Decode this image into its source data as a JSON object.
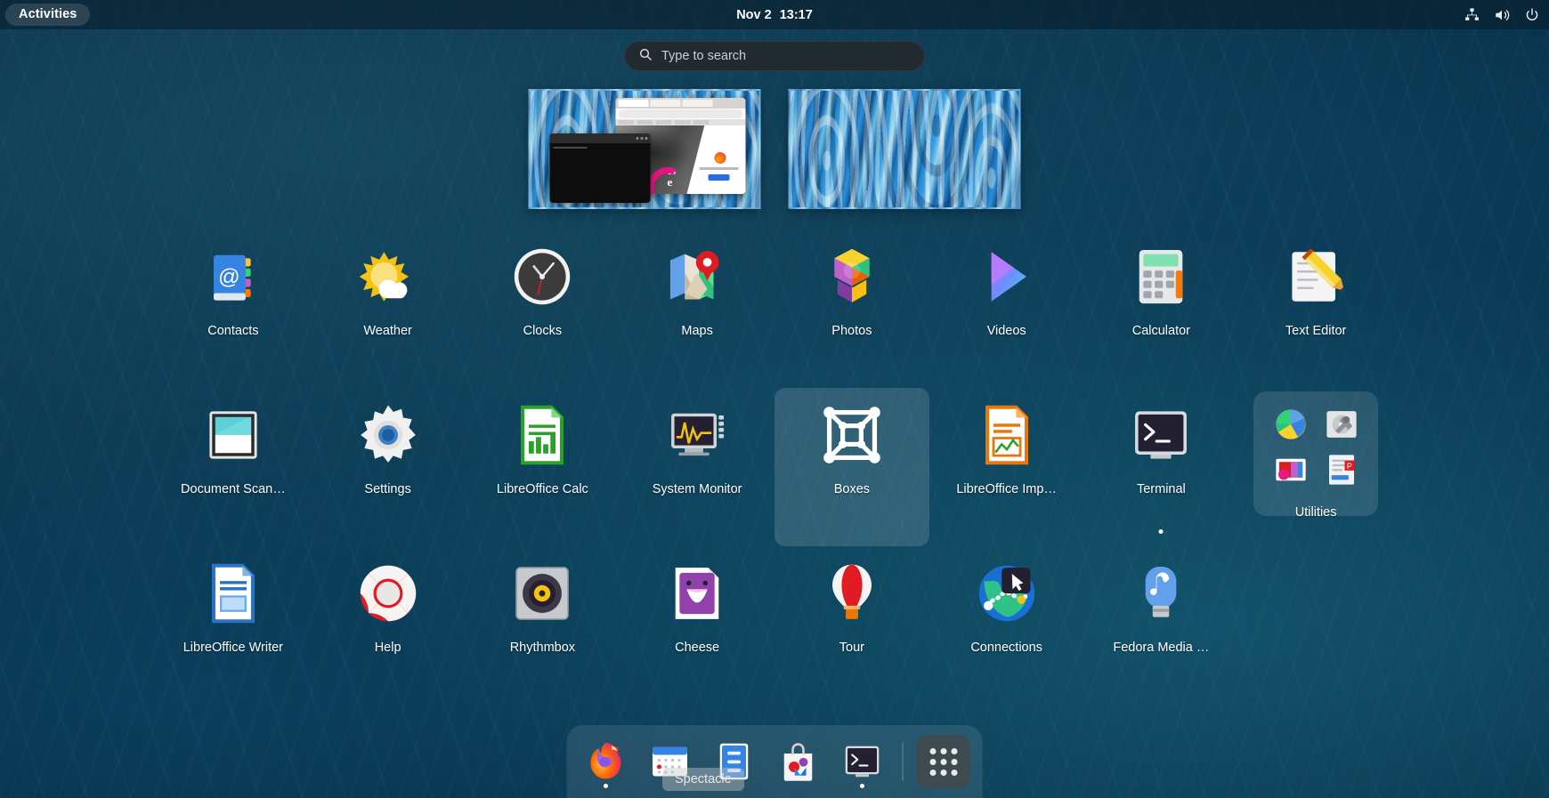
{
  "topbar": {
    "activities_label": "Activities",
    "date": "Nov 2",
    "time": "13:17",
    "tray": [
      {
        "name": "network-wired-icon",
        "label": "Network"
      },
      {
        "name": "volume-icon",
        "label": "Volume"
      },
      {
        "name": "power-icon",
        "label": "Power"
      }
    ]
  },
  "search": {
    "placeholder": "Type to search",
    "value": "",
    "icon": "search-icon"
  },
  "workspaces": [
    {
      "name": "workspace-1",
      "active": true,
      "windows": [
        "Firefox",
        "Terminal"
      ]
    },
    {
      "name": "workspace-2",
      "active": false,
      "windows": []
    }
  ],
  "appgrid": {
    "rows": [
      [
        {
          "label": "Contacts",
          "icon": "contacts-icon",
          "running": false,
          "highlight": false
        },
        {
          "label": "Weather",
          "icon": "weather-icon",
          "running": false,
          "highlight": false
        },
        {
          "label": "Clocks",
          "icon": "clocks-icon",
          "running": false,
          "highlight": false
        },
        {
          "label": "Maps",
          "icon": "maps-icon",
          "running": false,
          "highlight": false
        },
        {
          "label": "Photos",
          "icon": "photos-icon",
          "running": false,
          "highlight": false
        },
        {
          "label": "Videos",
          "icon": "videos-icon",
          "running": false,
          "highlight": false
        },
        {
          "label": "Calculator",
          "icon": "calculator-icon",
          "running": false,
          "highlight": false
        },
        {
          "label": "Text Editor",
          "icon": "text-editor-icon",
          "running": false,
          "highlight": false
        }
      ],
      [
        {
          "label": "Document Scan…",
          "icon": "document-scanner-icon",
          "running": false,
          "highlight": false
        },
        {
          "label": "Settings",
          "icon": "settings-icon",
          "running": false,
          "highlight": false
        },
        {
          "label": "LibreOffice Calc",
          "icon": "libreoffice-calc-icon",
          "running": false,
          "highlight": false
        },
        {
          "label": "System Monitor",
          "icon": "system-monitor-icon",
          "running": false,
          "highlight": false
        },
        {
          "label": "Boxes",
          "icon": "boxes-icon",
          "running": false,
          "highlight": true
        },
        {
          "label": "LibreOffice Imp…",
          "icon": "libreoffice-impress-icon",
          "running": false,
          "highlight": false
        },
        {
          "label": "Terminal",
          "icon": "terminal-icon",
          "running": true,
          "highlight": false
        },
        {
          "label": "Utilities",
          "icon": "utilities-folder-icon",
          "running": false,
          "highlight": false,
          "folder": true
        }
      ],
      [
        {
          "label": "LibreOffice Writer",
          "icon": "libreoffice-writer-icon",
          "running": false,
          "highlight": false
        },
        {
          "label": "Help",
          "icon": "help-icon",
          "running": false,
          "highlight": false
        },
        {
          "label": "Rhythmbox",
          "icon": "rhythmbox-icon",
          "running": false,
          "highlight": false
        },
        {
          "label": "Cheese",
          "icon": "cheese-icon",
          "running": false,
          "highlight": false
        },
        {
          "label": "Tour",
          "icon": "tour-icon",
          "running": false,
          "highlight": false
        },
        {
          "label": "Connections",
          "icon": "connections-icon",
          "running": false,
          "highlight": false
        },
        {
          "label": "Fedora Media …",
          "icon": "fedora-media-writer-icon",
          "running": false,
          "highlight": false
        }
      ]
    ],
    "utilities_folder": [
      {
        "label": "Disk Usage Analyzer",
        "icon": "disk-usage-analyzer-icon"
      },
      {
        "label": "Disks",
        "icon": "disks-icon"
      },
      {
        "label": "Screenshot",
        "icon": "screenshot-icon"
      },
      {
        "label": "Logs",
        "icon": "logs-icon"
      }
    ]
  },
  "dash": {
    "items": [
      {
        "label": "Firefox",
        "icon": "firefox-icon",
        "running": true
      },
      {
        "label": "Calendar",
        "icon": "calendar-icon",
        "running": false
      },
      {
        "label": "Files",
        "icon": "files-icon",
        "running": false
      },
      {
        "label": "Software",
        "icon": "software-icon",
        "running": false
      },
      {
        "label": "Terminal",
        "icon": "terminal-icon",
        "running": true
      }
    ],
    "apps_button_label": "Show Applications"
  },
  "tooltip": {
    "text": "Spectacle"
  },
  "colors": {
    "accent": "#3584e4",
    "topbar_bg": "#0a1a26",
    "highlight": "#ffffff"
  }
}
